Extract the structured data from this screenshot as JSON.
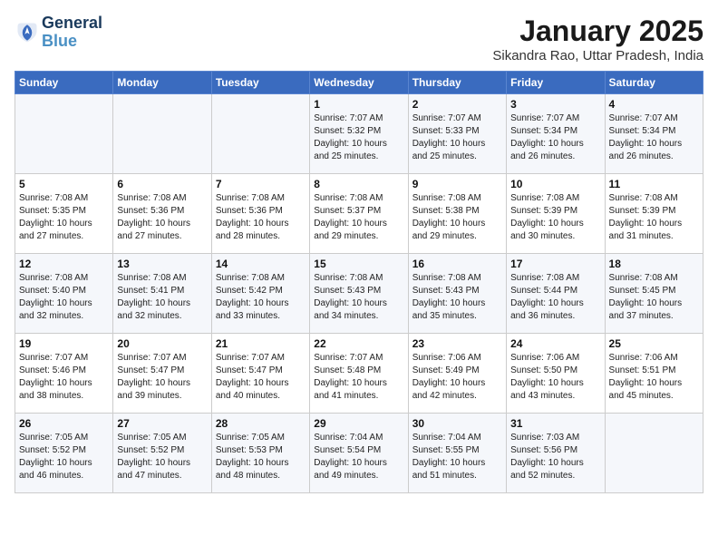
{
  "header": {
    "logo_line1": "General",
    "logo_line2": "Blue",
    "title": "January 2025",
    "subtitle": "Sikandra Rao, Uttar Pradesh, India"
  },
  "days_of_week": [
    "Sunday",
    "Monday",
    "Tuesday",
    "Wednesday",
    "Thursday",
    "Friday",
    "Saturday"
  ],
  "weeks": [
    [
      {
        "day": "",
        "content": ""
      },
      {
        "day": "",
        "content": ""
      },
      {
        "day": "",
        "content": ""
      },
      {
        "day": "1",
        "content": "Sunrise: 7:07 AM\nSunset: 5:32 PM\nDaylight: 10 hours\nand 25 minutes."
      },
      {
        "day": "2",
        "content": "Sunrise: 7:07 AM\nSunset: 5:33 PM\nDaylight: 10 hours\nand 25 minutes."
      },
      {
        "day": "3",
        "content": "Sunrise: 7:07 AM\nSunset: 5:34 PM\nDaylight: 10 hours\nand 26 minutes."
      },
      {
        "day": "4",
        "content": "Sunrise: 7:07 AM\nSunset: 5:34 PM\nDaylight: 10 hours\nand 26 minutes."
      }
    ],
    [
      {
        "day": "5",
        "content": "Sunrise: 7:08 AM\nSunset: 5:35 PM\nDaylight: 10 hours\nand 27 minutes."
      },
      {
        "day": "6",
        "content": "Sunrise: 7:08 AM\nSunset: 5:36 PM\nDaylight: 10 hours\nand 27 minutes."
      },
      {
        "day": "7",
        "content": "Sunrise: 7:08 AM\nSunset: 5:36 PM\nDaylight: 10 hours\nand 28 minutes."
      },
      {
        "day": "8",
        "content": "Sunrise: 7:08 AM\nSunset: 5:37 PM\nDaylight: 10 hours\nand 29 minutes."
      },
      {
        "day": "9",
        "content": "Sunrise: 7:08 AM\nSunset: 5:38 PM\nDaylight: 10 hours\nand 29 minutes."
      },
      {
        "day": "10",
        "content": "Sunrise: 7:08 AM\nSunset: 5:39 PM\nDaylight: 10 hours\nand 30 minutes."
      },
      {
        "day": "11",
        "content": "Sunrise: 7:08 AM\nSunset: 5:39 PM\nDaylight: 10 hours\nand 31 minutes."
      }
    ],
    [
      {
        "day": "12",
        "content": "Sunrise: 7:08 AM\nSunset: 5:40 PM\nDaylight: 10 hours\nand 32 minutes."
      },
      {
        "day": "13",
        "content": "Sunrise: 7:08 AM\nSunset: 5:41 PM\nDaylight: 10 hours\nand 32 minutes."
      },
      {
        "day": "14",
        "content": "Sunrise: 7:08 AM\nSunset: 5:42 PM\nDaylight: 10 hours\nand 33 minutes."
      },
      {
        "day": "15",
        "content": "Sunrise: 7:08 AM\nSunset: 5:43 PM\nDaylight: 10 hours\nand 34 minutes."
      },
      {
        "day": "16",
        "content": "Sunrise: 7:08 AM\nSunset: 5:43 PM\nDaylight: 10 hours\nand 35 minutes."
      },
      {
        "day": "17",
        "content": "Sunrise: 7:08 AM\nSunset: 5:44 PM\nDaylight: 10 hours\nand 36 minutes."
      },
      {
        "day": "18",
        "content": "Sunrise: 7:08 AM\nSunset: 5:45 PM\nDaylight: 10 hours\nand 37 minutes."
      }
    ],
    [
      {
        "day": "19",
        "content": "Sunrise: 7:07 AM\nSunset: 5:46 PM\nDaylight: 10 hours\nand 38 minutes."
      },
      {
        "day": "20",
        "content": "Sunrise: 7:07 AM\nSunset: 5:47 PM\nDaylight: 10 hours\nand 39 minutes."
      },
      {
        "day": "21",
        "content": "Sunrise: 7:07 AM\nSunset: 5:47 PM\nDaylight: 10 hours\nand 40 minutes."
      },
      {
        "day": "22",
        "content": "Sunrise: 7:07 AM\nSunset: 5:48 PM\nDaylight: 10 hours\nand 41 minutes."
      },
      {
        "day": "23",
        "content": "Sunrise: 7:06 AM\nSunset: 5:49 PM\nDaylight: 10 hours\nand 42 minutes."
      },
      {
        "day": "24",
        "content": "Sunrise: 7:06 AM\nSunset: 5:50 PM\nDaylight: 10 hours\nand 43 minutes."
      },
      {
        "day": "25",
        "content": "Sunrise: 7:06 AM\nSunset: 5:51 PM\nDaylight: 10 hours\nand 45 minutes."
      }
    ],
    [
      {
        "day": "26",
        "content": "Sunrise: 7:05 AM\nSunset: 5:52 PM\nDaylight: 10 hours\nand 46 minutes."
      },
      {
        "day": "27",
        "content": "Sunrise: 7:05 AM\nSunset: 5:52 PM\nDaylight: 10 hours\nand 47 minutes."
      },
      {
        "day": "28",
        "content": "Sunrise: 7:05 AM\nSunset: 5:53 PM\nDaylight: 10 hours\nand 48 minutes."
      },
      {
        "day": "29",
        "content": "Sunrise: 7:04 AM\nSunset: 5:54 PM\nDaylight: 10 hours\nand 49 minutes."
      },
      {
        "day": "30",
        "content": "Sunrise: 7:04 AM\nSunset: 5:55 PM\nDaylight: 10 hours\nand 51 minutes."
      },
      {
        "day": "31",
        "content": "Sunrise: 7:03 AM\nSunset: 5:56 PM\nDaylight: 10 hours\nand 52 minutes."
      },
      {
        "day": "",
        "content": ""
      }
    ]
  ]
}
